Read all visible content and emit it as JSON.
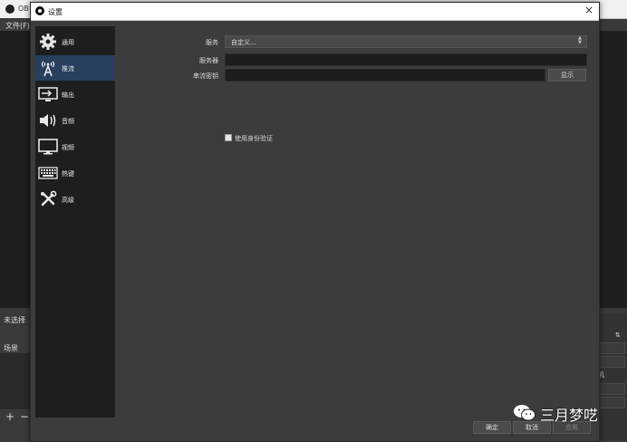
{
  "background": {
    "title": "OB",
    "menu_file": "文件(F)",
    "scene_header": "未选择",
    "scenes_title": "场景",
    "add_symbol": "+",
    "remove_symbol": "−",
    "right_text": "机",
    "right_glyph": "⇅"
  },
  "dialog": {
    "title": "设置",
    "close_symbol": "×"
  },
  "sidebar": {
    "items": [
      {
        "label": "通用",
        "icon": "gear-icon"
      },
      {
        "label": "推流",
        "icon": "broadcast-antenna-icon",
        "active": true
      },
      {
        "label": "输出",
        "icon": "output-icon"
      },
      {
        "label": "音频",
        "icon": "speaker-icon"
      },
      {
        "label": "视频",
        "icon": "monitor-icon"
      },
      {
        "label": "热键",
        "icon": "keyboard-icon"
      },
      {
        "label": "高级",
        "icon": "tools-icon"
      }
    ]
  },
  "stream": {
    "service_label": "服务",
    "service_value": "自定义...",
    "server_label": "服务器",
    "server_value": "",
    "key_label": "串流密钥",
    "key_value": "",
    "show_button": "显示",
    "auth_label": "使用身份验证"
  },
  "buttons": {
    "ok": "确定",
    "cancel": "取消",
    "apply": "应用"
  },
  "watermark": {
    "text": "三月梦呓"
  },
  "colors": {
    "sidebar_active": "#283f5e",
    "dialog_bg": "#3c3c3c",
    "field_bg": "#1c1c1c"
  }
}
